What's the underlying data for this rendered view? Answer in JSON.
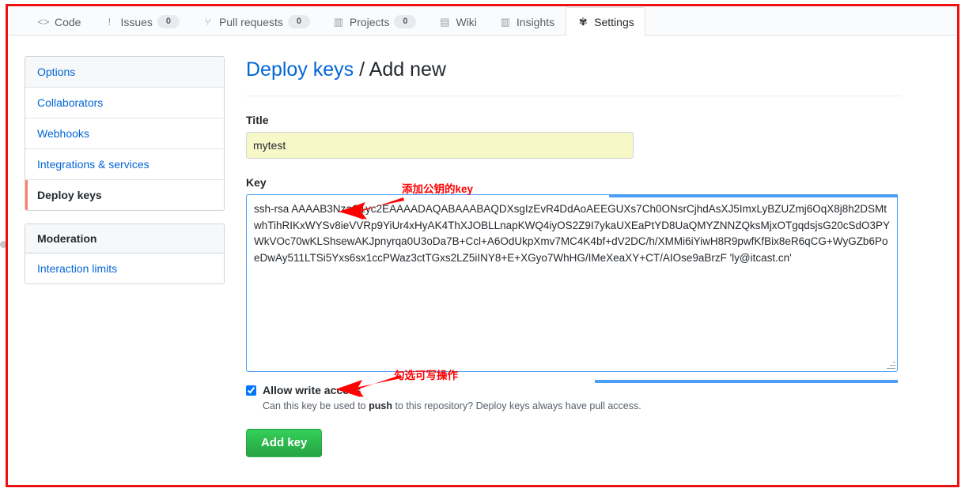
{
  "tabbar": {
    "tabs": [
      {
        "label": "Code",
        "icon": "code-icon",
        "glyph": "<>",
        "count": null,
        "selected": false
      },
      {
        "label": "Issues",
        "icon": "issue-opened-icon",
        "glyph": "!",
        "count": "0",
        "selected": false
      },
      {
        "label": "Pull requests",
        "icon": "git-pull-request-icon",
        "glyph": "⑂",
        "count": "0",
        "selected": false
      },
      {
        "label": "Projects",
        "icon": "project-icon",
        "glyph": "▥",
        "count": "0",
        "selected": false
      },
      {
        "label": "Wiki",
        "icon": "book-icon",
        "glyph": "▤",
        "count": null,
        "selected": false
      },
      {
        "label": "Insights",
        "icon": "graph-icon",
        "glyph": "▥",
        "count": null,
        "selected": false
      },
      {
        "label": "Settings",
        "icon": "gear-icon",
        "glyph": "✾",
        "count": null,
        "selected": true
      }
    ]
  },
  "sidebar": {
    "menu_primary": [
      {
        "label": "Options",
        "state": "link-heading"
      },
      {
        "label": "Collaborators",
        "state": "link"
      },
      {
        "label": "Webhooks",
        "state": "link"
      },
      {
        "label": "Integrations & services",
        "state": "link"
      },
      {
        "label": "Deploy keys",
        "state": "selected"
      }
    ],
    "menu_moderation": {
      "heading": "Moderation",
      "items": [
        {
          "label": "Interaction limits",
          "state": "link"
        }
      ]
    }
  },
  "main": {
    "title_link": "Deploy keys",
    "title_separator": " / ",
    "title_current": "Add new",
    "title_label": "Title",
    "title_value": "mytest",
    "title_placeholder": "",
    "key_label": "Key",
    "key_value": "ssh-rsa AAAAB3NzaC1yc2EAAAADAQABAAABAQDXsgIzEvR4DdAoAEEGUXs7Ch0ONsrCjhdAsXJ5ImxLyBZUZmj6OqX8j8h2DSMtwhTihRIKxWYSv8ieVVRp9YiUr4xHyAK4ThXJOBLLnapKWQ4iyOS2Z9I7ykaUXEaPtYD8UaQMYZNNZQksMjxOTgqdsjsG20cSdO3PYWkVOc70wKLShsewAKJpnyrqa0U3oDa7B+Ccl+A6OdUkpXmv7MC4K4bf+dV2DC/h/XMMi6iYiwH8R9pwfKfBix8eR6qCG+WyGZb6PoeDwAy511LTSi5Yxs6sx1ccPWaz3ctTGxs2LZ5iINY8+E+XGyo7WhHG/IMeXeaXY+CT/AIOse9aBrzF 'ly@itcast.cn'",
    "key_placeholder": "",
    "allow_write_label": "Allow write access",
    "allow_write_checked": true,
    "help_prefix": "Can this key be used to ",
    "help_strong": "push",
    "help_suffix": " to this repository? Deploy keys always have pull access.",
    "submit_label": "Add key"
  },
  "annotations": [
    {
      "text": "添加公钥的key",
      "color": "#ff0000",
      "target": "key-textarea"
    },
    {
      "text": "勾选可写操作",
      "color": "#ff0000",
      "target": "allow-write-checkbox"
    }
  ],
  "colors": {
    "annotation_red": "#ff0000",
    "frame_red": "#ee1111",
    "link_blue": "#0366d6",
    "focus_blue": "#4a9ef5",
    "button_green": "#28a745",
    "autofill_yellow": "#f7f8c8",
    "selected_marker_orange": "#f9826c"
  }
}
